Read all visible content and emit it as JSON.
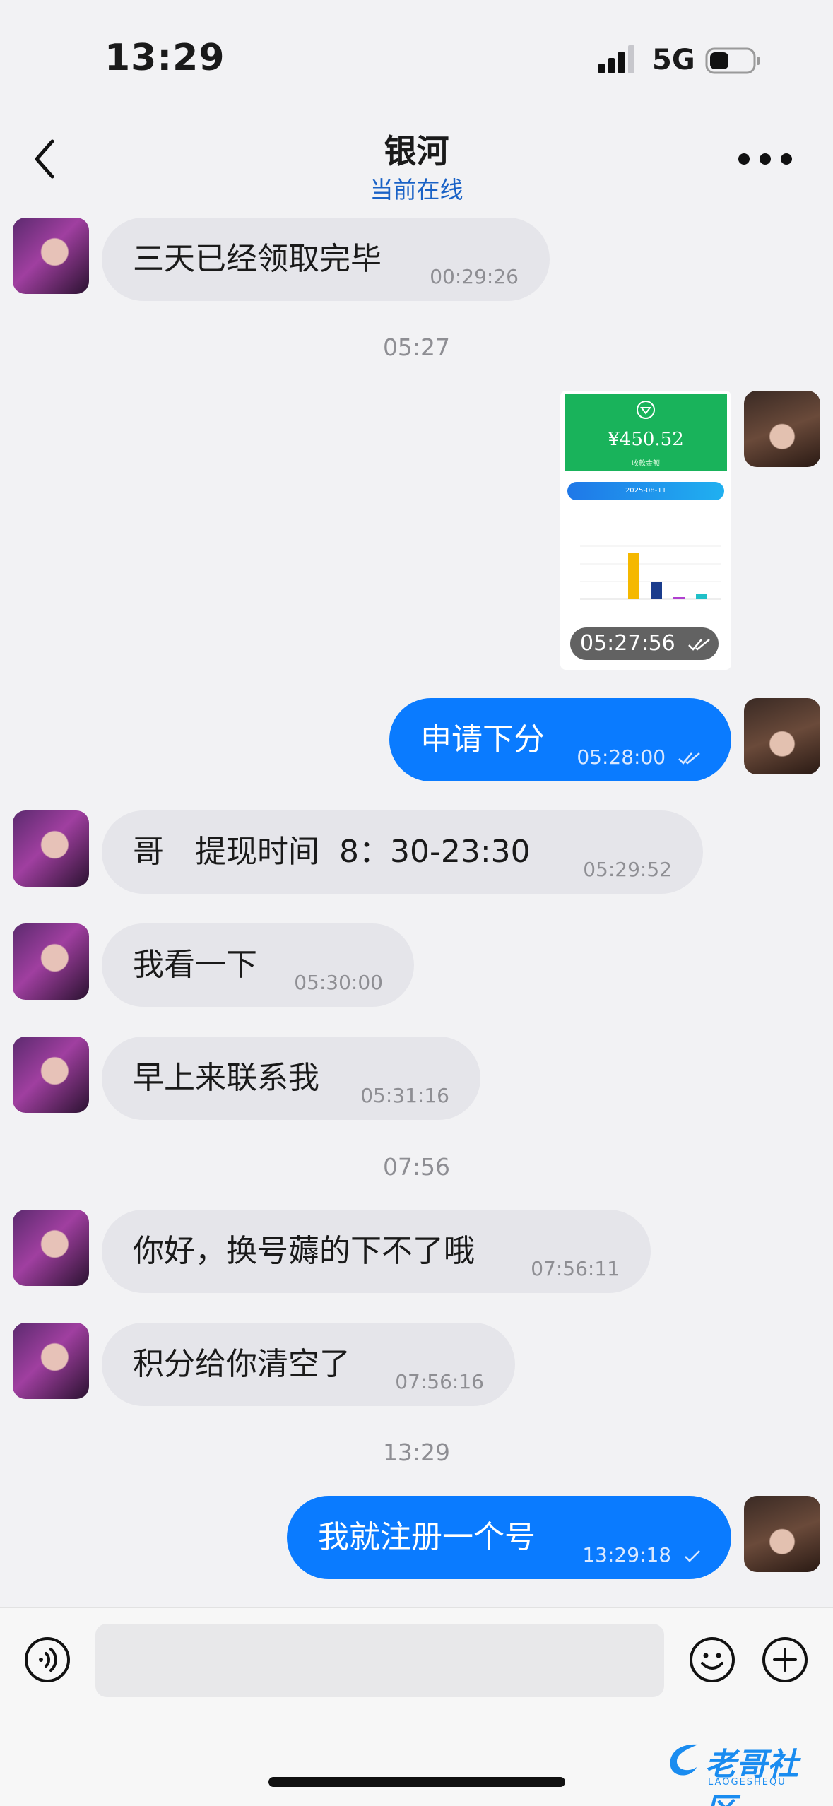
{
  "status_bar": {
    "time": "13:29",
    "network": "5G",
    "battery_icon": "battery-icon",
    "signal_icon": "signal-icon"
  },
  "header": {
    "title": "银河",
    "subtitle": "当前在线",
    "back_icon": "chevron-left-icon",
    "more_icon": "more-dots-icon"
  },
  "messages": [
    {
      "side": "in",
      "text": "三天已经领取完毕",
      "time": "00:29:26"
    },
    {
      "type": "separator",
      "text": "05:27"
    },
    {
      "side": "out",
      "type": "image",
      "time": "05:27:56",
      "image": {
        "amount": "¥450.52",
        "subtitle": "收款金额",
        "date": "2025-08-11"
      }
    },
    {
      "side": "out",
      "text": "申请下分",
      "time": "05:28:00",
      "status": "read"
    },
    {
      "side": "in",
      "text": "哥　提现时间  8：30-23:30",
      "time": "05:29:52"
    },
    {
      "side": "in",
      "text": "我看一下",
      "time": "05:30:00"
    },
    {
      "side": "in",
      "text": "早上来联系我",
      "time": "05:31:16"
    },
    {
      "type": "separator",
      "text": "07:56"
    },
    {
      "side": "in",
      "text": "你好，换号薅的下不了哦",
      "time": "07:56:11"
    },
    {
      "side": "in",
      "text": "积分给你清空了",
      "time": "07:56:16"
    },
    {
      "type": "separator",
      "text": "13:29"
    },
    {
      "side": "out",
      "text": "我就注册一个号",
      "time": "13:29:18",
      "status": "sent"
    }
  ],
  "input_bar": {
    "placeholder": "",
    "voice_icon": "voice-icon",
    "emoji_icon": "emoji-icon",
    "plus_icon": "plus-icon"
  },
  "watermark": {
    "text": "老哥社区",
    "sub": "LAOGESHEQU"
  },
  "colors": {
    "accent": "#0a7bff",
    "incoming": "#e5e5ea",
    "online": "#1a62c6"
  }
}
